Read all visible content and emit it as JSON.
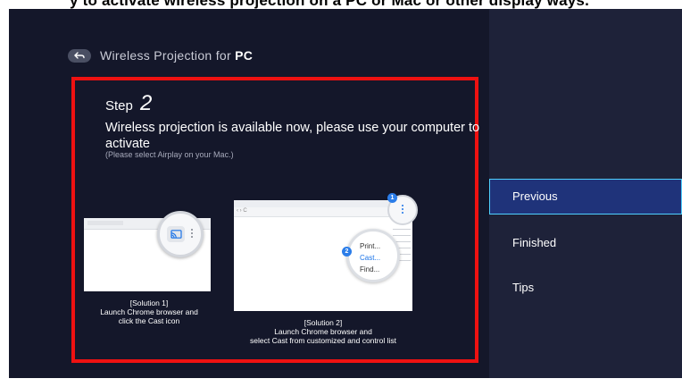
{
  "top_banner_text": "y to activate wireless projection on a PC or Mac or other display ways.",
  "header": {
    "back_icon": "back-arrow-icon",
    "title_prefix": "Wireless Projection for ",
    "title_bold": "PC"
  },
  "step": {
    "label": "Step",
    "number": "2",
    "description": "Wireless projection is available now, please use your computer to activate",
    "note": "(Please select Airplay on your Mac.)"
  },
  "solution1": {
    "caption_line1": "[Solution 1]",
    "caption_line2": "Launch Chrome browser and",
    "caption_line3": "click the Cast icon",
    "icon": "cast-icon"
  },
  "solution2": {
    "caption_line1": "[Solution 2]",
    "caption_line2": "Launch Chrome browser and",
    "caption_line3": "select Cast from customized and control list",
    "menu_items": [
      "Print...",
      "Cast...",
      "Find..."
    ],
    "badge1": "1",
    "badge2": "2"
  },
  "menu": {
    "items": [
      {
        "label": "Previous",
        "selected": true
      },
      {
        "label": "Finished",
        "selected": false
      },
      {
        "label": "Tips",
        "selected": false
      }
    ]
  },
  "colors": {
    "background": "#14172a",
    "panel": "#1e2239",
    "selected_bg": "#1f337a",
    "selected_border": "#4fd0ff",
    "highlight_frame": "#ee1111",
    "accent_blue": "#2b7de9"
  }
}
